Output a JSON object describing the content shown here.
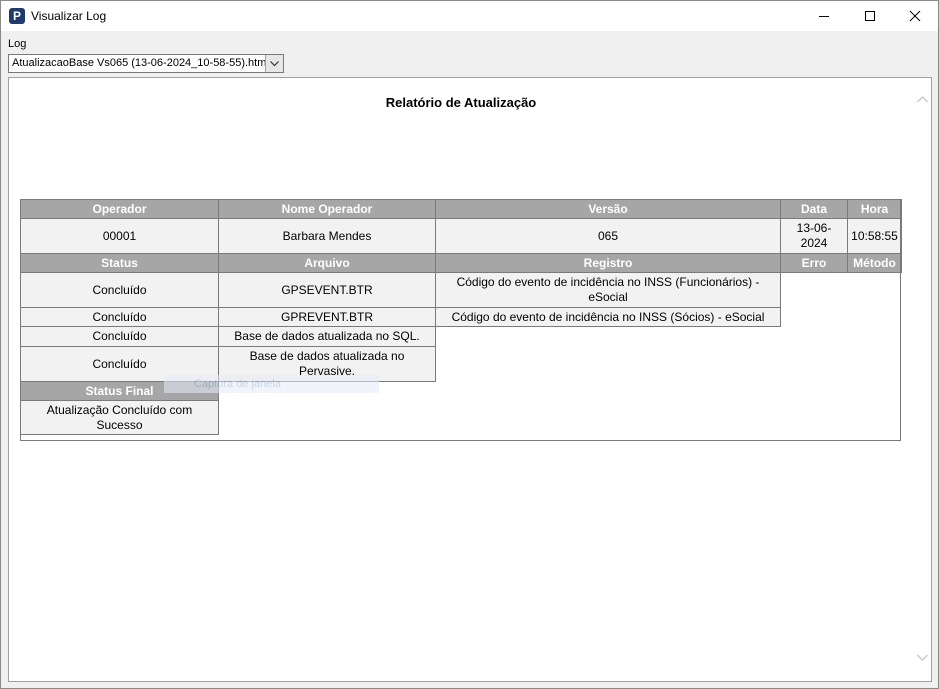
{
  "window": {
    "title": "Visualizar Log",
    "app_icon_letter": "P"
  },
  "log_selector": {
    "label": "Log",
    "value": "AtualizacaoBase Vs065 (13-06-2024_10-58-55).html"
  },
  "report": {
    "title": "Relatório de Atualização",
    "header1": {
      "operador": "Operador",
      "nome_operador": "Nome Operador",
      "versao": "Versão",
      "data": "Data",
      "hora": "Hora"
    },
    "info": {
      "operador": "00001",
      "nome_operador": "Barbara Mendes",
      "versao": "065",
      "data": "13-06-2024",
      "hora": "10:58:55"
    },
    "header2": {
      "status": "Status",
      "arquivo": "Arquivo",
      "registro": "Registro",
      "erro": "Erro",
      "metodo": "Método"
    },
    "rows": [
      {
        "status": "Concluído",
        "arquivo": "GPSEVENT.BTR",
        "registro": "Código do evento de incidência no INSS (Funcionários) - eSocial"
      },
      {
        "status": "Concluído",
        "arquivo": "GPREVENT.BTR",
        "registro": "Código do evento de incidência no INSS (Sócios) - eSocial"
      },
      {
        "status": "Concluído",
        "arquivo": "Base de dados atualizada no SQL."
      },
      {
        "status": "Concluído",
        "arquivo": "Base de dados atualizada no Pervasive."
      }
    ],
    "status_final_header": "Status Final",
    "status_final": "Atualização Concluído com Sucesso"
  },
  "ghost_tooltip": "Captura de janela"
}
